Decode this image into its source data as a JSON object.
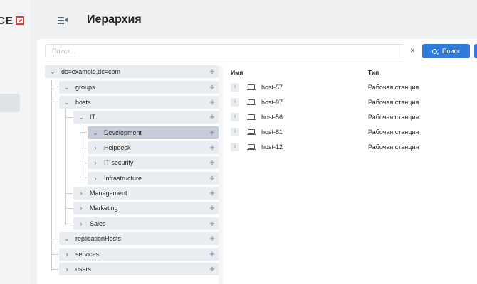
{
  "app": {
    "logo_text": "CE"
  },
  "header": {
    "title": "Иерархия"
  },
  "search": {
    "placeholder": "Поиск...",
    "clear_symbol": "×",
    "button_label": "Поиск"
  },
  "tree": {
    "nodes": [
      {
        "label": "dc=example,dc=com",
        "expanded": true
      },
      {
        "label": "groups",
        "expanded": true
      },
      {
        "label": "hosts",
        "expanded": true
      },
      {
        "label": "IT",
        "expanded": true
      },
      {
        "label": "Development",
        "expanded": true,
        "selected": true
      },
      {
        "label": "Helpdesk",
        "expanded": false
      },
      {
        "label": "IT security",
        "expanded": false
      },
      {
        "label": "Infrastructure",
        "expanded": false
      },
      {
        "label": "Management",
        "expanded": false
      },
      {
        "label": "Marketing",
        "expanded": false
      },
      {
        "label": "Sales",
        "expanded": false
      },
      {
        "label": "replicationHosts",
        "expanded": true
      },
      {
        "label": "services",
        "expanded": false
      },
      {
        "label": "users",
        "expanded": false
      }
    ]
  },
  "table": {
    "columns": [
      "Имя",
      "Тип"
    ],
    "rows": [
      {
        "name": "host-57",
        "type": "Рабочая станция"
      },
      {
        "name": "host-97",
        "type": "Рабочая станция"
      },
      {
        "name": "host-56",
        "type": "Рабочая станция"
      },
      {
        "name": "host-81",
        "type": "Рабочая станция"
      },
      {
        "name": "host-12",
        "type": "Рабочая станция"
      }
    ],
    "info_symbol": "i"
  },
  "colors": {
    "accent": "#2f7bd9",
    "brand_mark": "#d83c3c",
    "selected_node": "#c3ced8"
  },
  "icons": [
    "menu-collapse-icon",
    "search-icon",
    "close-icon",
    "chevron-down-icon",
    "chevron-right-icon",
    "plus-icon",
    "info-icon",
    "laptop-icon"
  ]
}
